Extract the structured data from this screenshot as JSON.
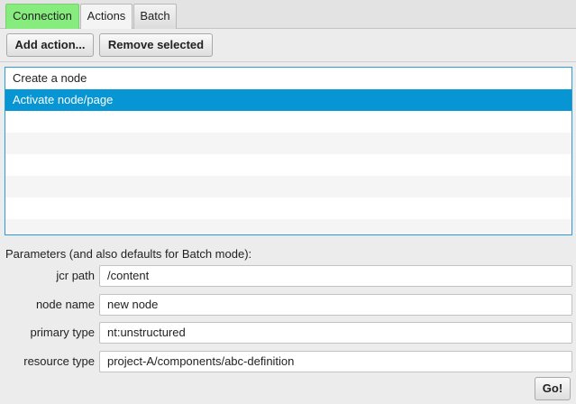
{
  "tabs": [
    {
      "label": "Connection"
    },
    {
      "label": "Actions"
    },
    {
      "label": "Batch"
    }
  ],
  "toolbar": {
    "add_label": "Add action...",
    "remove_label": "Remove selected"
  },
  "actions_list": {
    "items": [
      {
        "label": "Create a node"
      },
      {
        "label": "Activate node/page"
      }
    ],
    "selected_index": 1
  },
  "parameters": {
    "title": "Parameters (and also defaults for Batch mode):",
    "fields": [
      {
        "label": "jcr path",
        "value": "/content"
      },
      {
        "label": "node name",
        "value": "new node"
      },
      {
        "label": "primary type",
        "value": "nt:unstructured"
      },
      {
        "label": "resource type",
        "value": "project-A/components/abc-definition"
      }
    ]
  },
  "go_label": "Go!",
  "colors": {
    "connection_tab": "#86ec7e",
    "selection": "#0795d3",
    "list_border": "#2a9bd4"
  }
}
